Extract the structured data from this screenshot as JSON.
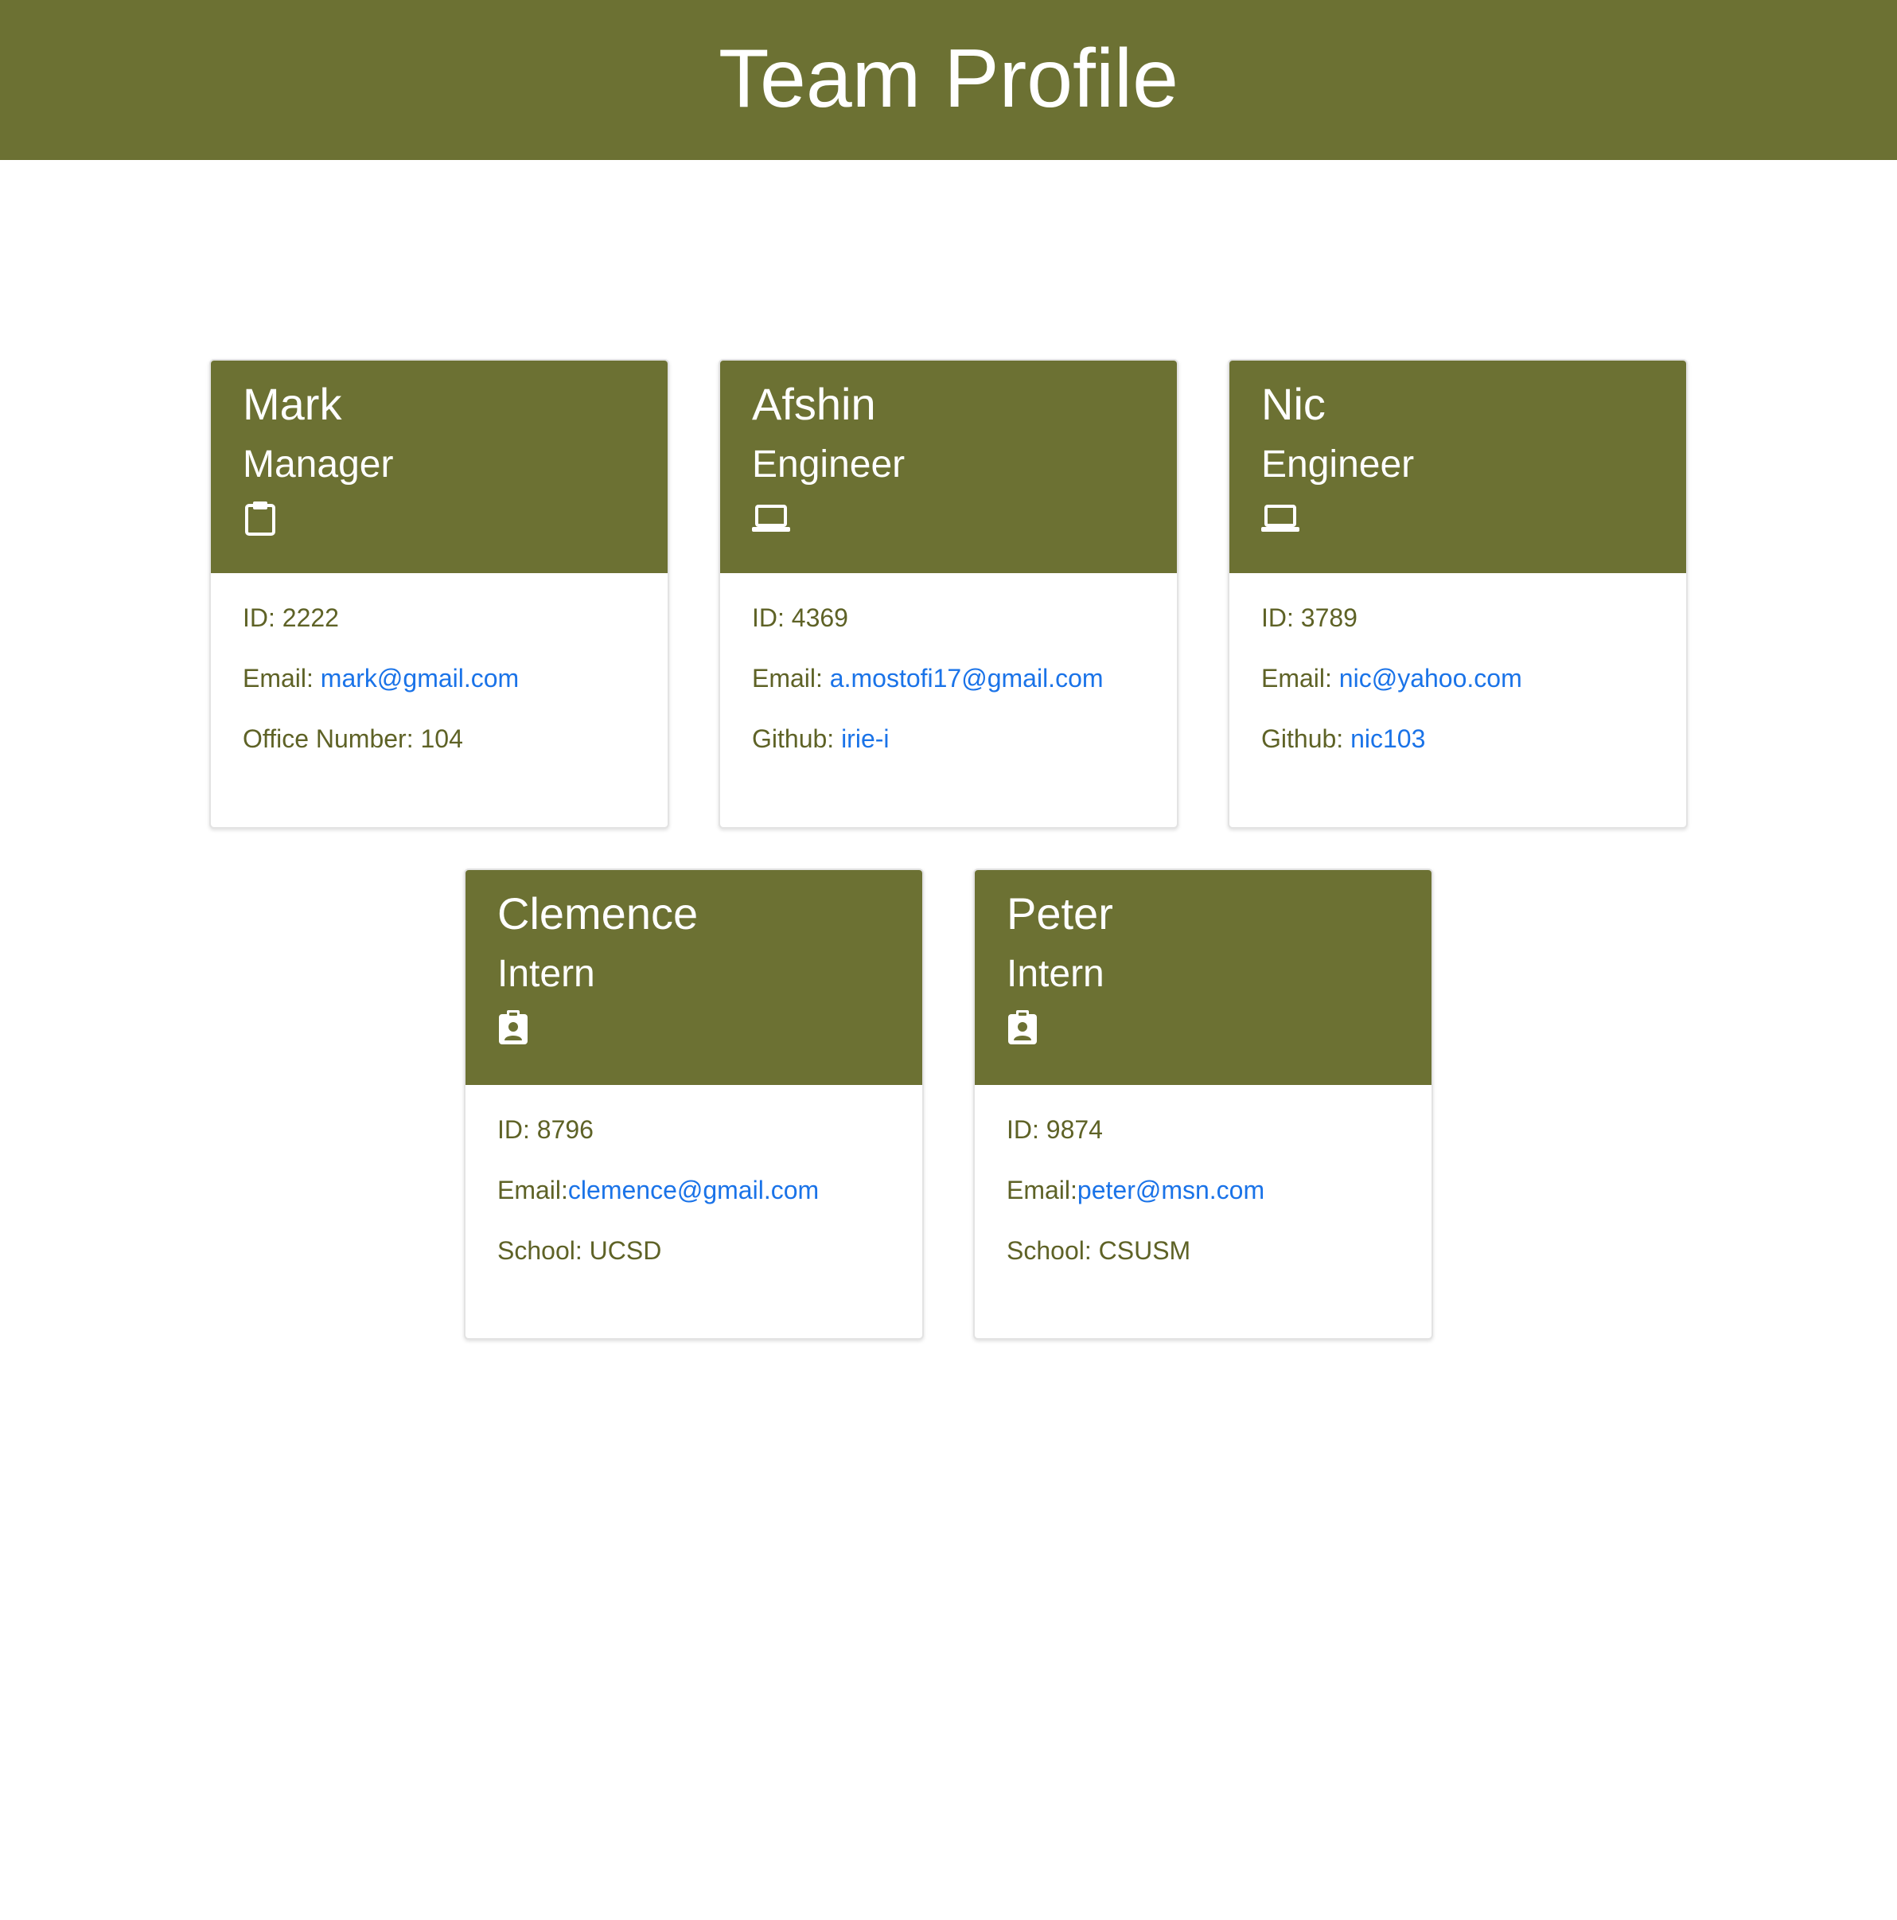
{
  "page": {
    "title": "Team Profile",
    "header_color": "#6c7133",
    "link_color": "#1a73e8"
  },
  "members": [
    {
      "name": "Mark",
      "role": "Manager",
      "icon": "clipboard-icon",
      "id_text": "ID: 2222",
      "email_label": "Email: ",
      "email": "mark@gmail.com",
      "extra_label": "Office Number: 104",
      "extra_value": ""
    },
    {
      "name": "Afshin",
      "role": "Engineer",
      "icon": "laptop-icon",
      "id_text": "ID: 4369",
      "email_label": "Email: ",
      "email": "a.mostofi17@gmail.com",
      "extra_label": "Github: ",
      "extra_value": "irie-i"
    },
    {
      "name": "Nic",
      "role": "Engineer",
      "icon": "laptop-icon",
      "id_text": "ID: 3789",
      "email_label": "Email: ",
      "email": "nic@yahoo.com",
      "extra_label": "Github: ",
      "extra_value": "nic103"
    },
    {
      "name": "Clemence",
      "role": "Intern",
      "icon": "id-badge-icon",
      "id_text": "ID: 8796",
      "email_label": "Email:",
      "email": "clemence@gmail.com",
      "extra_label": "School: UCSD",
      "extra_value": ""
    },
    {
      "name": "Peter",
      "role": "Intern",
      "icon": "id-badge-icon",
      "id_text": "ID: 9874",
      "email_label": "Email:",
      "email": "peter@msn.com",
      "extra_label": "School: CSUSM",
      "extra_value": ""
    }
  ]
}
